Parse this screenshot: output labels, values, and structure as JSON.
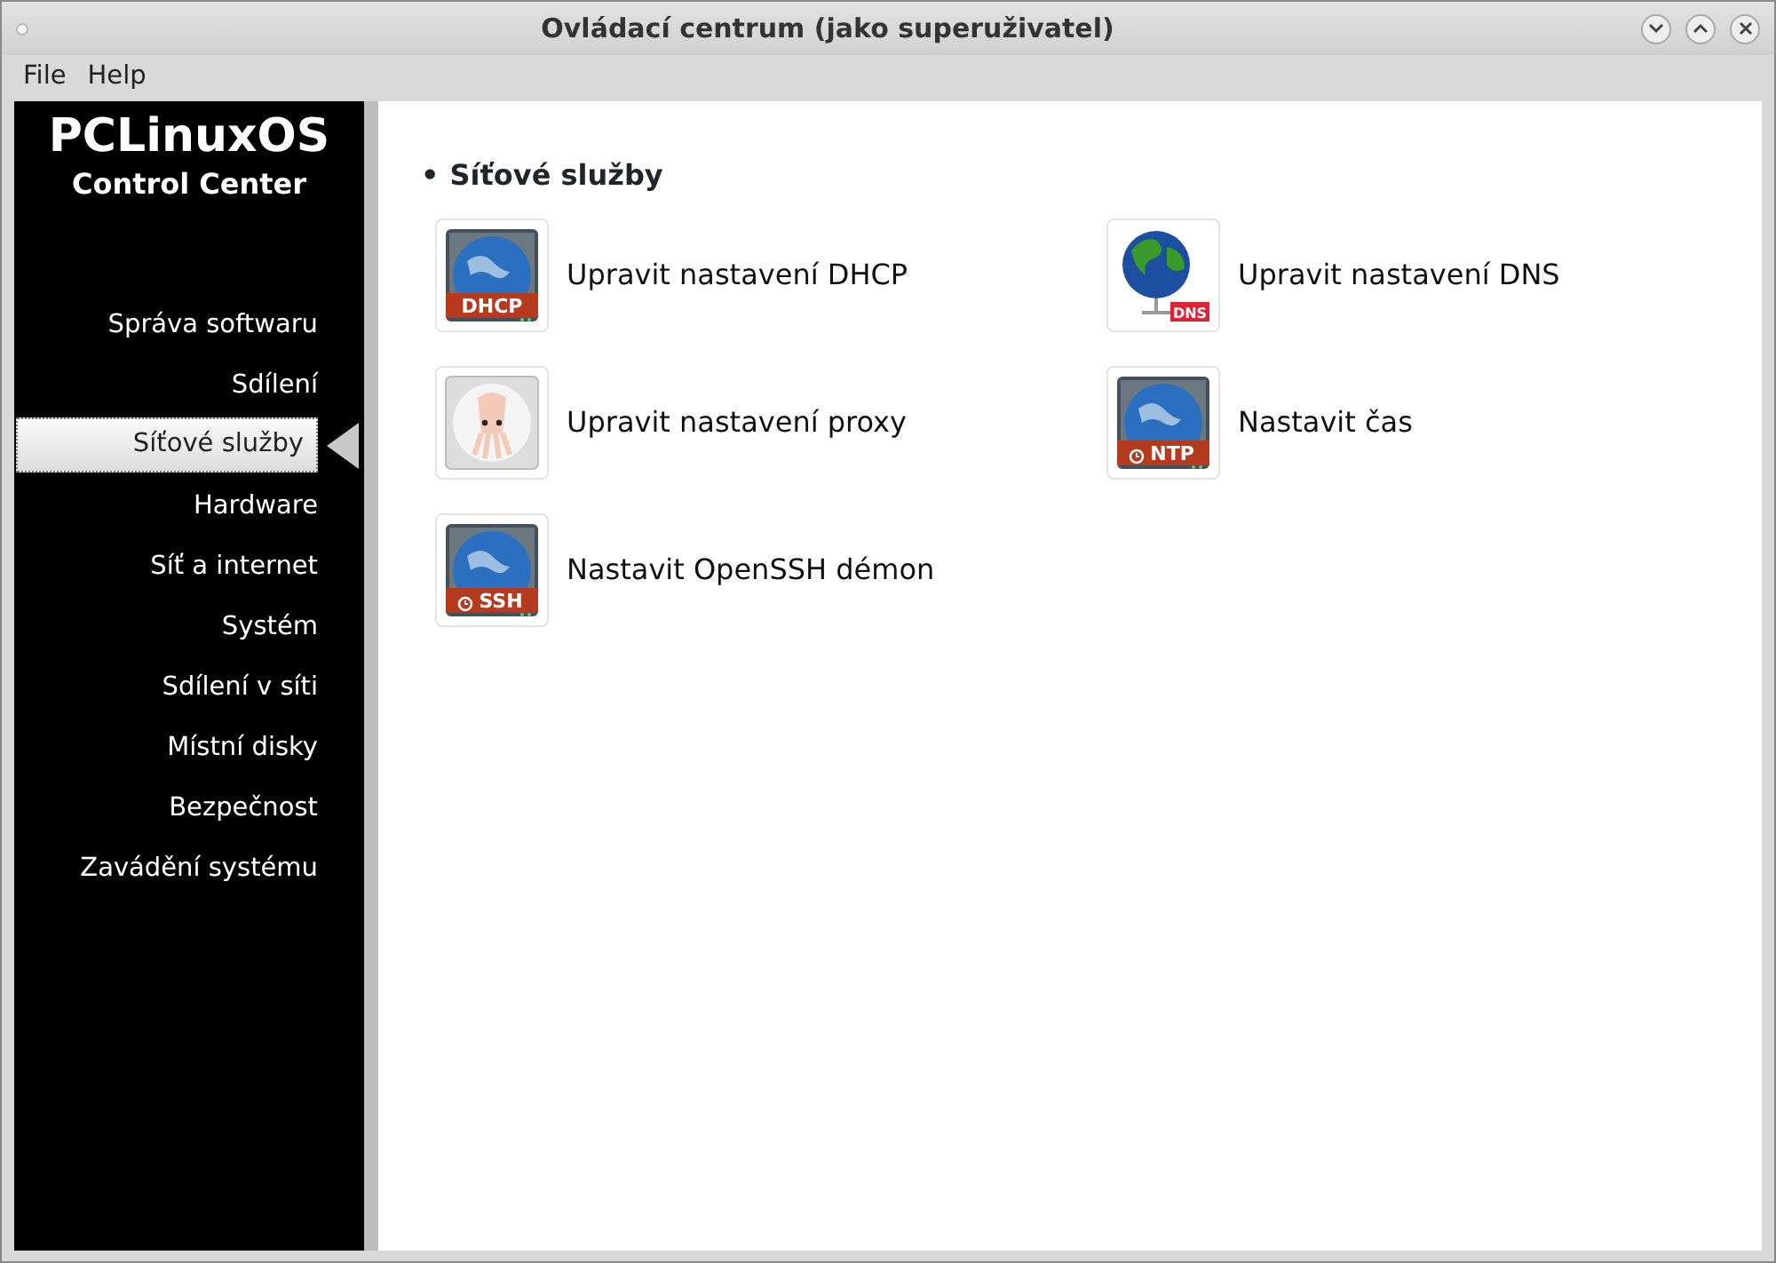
{
  "window": {
    "title": "Ovládací centrum (jako superuživatel)"
  },
  "menu": [
    "File",
    "Help"
  ],
  "sidebar": {
    "logo_title": "PCLinuxOS",
    "logo_subtitle": "Control Center",
    "items": [
      {
        "label": "Správa softwaru",
        "selected": false
      },
      {
        "label": "Sdílení",
        "selected": false
      },
      {
        "label": "Síťové služby",
        "selected": true
      },
      {
        "label": "Hardware",
        "selected": false
      },
      {
        "label": "Síť a internet",
        "selected": false
      },
      {
        "label": "Systém",
        "selected": false
      },
      {
        "label": "Sdílení v síti",
        "selected": false
      },
      {
        "label": "Místní disky",
        "selected": false
      },
      {
        "label": "Bezpečnost",
        "selected": false
      },
      {
        "label": "Zavádění systému",
        "selected": false
      }
    ]
  },
  "section": {
    "bullet": "•",
    "title": "Síťové služby",
    "tools": [
      {
        "label": "Upravit nastavení DHCP",
        "kind": "server",
        "badge": "DHCP",
        "clock": false
      },
      {
        "label": "Upravit nastavení DNS",
        "kind": "globe",
        "badge": "DNS"
      },
      {
        "label": "Upravit nastavení proxy",
        "kind": "proxy"
      },
      {
        "label": "Nastavit čas",
        "kind": "server",
        "badge": "NTP",
        "clock": true
      },
      {
        "label": "Nastavit OpenSSH démon",
        "kind": "server",
        "badge": "SSH",
        "clock": true
      }
    ]
  }
}
